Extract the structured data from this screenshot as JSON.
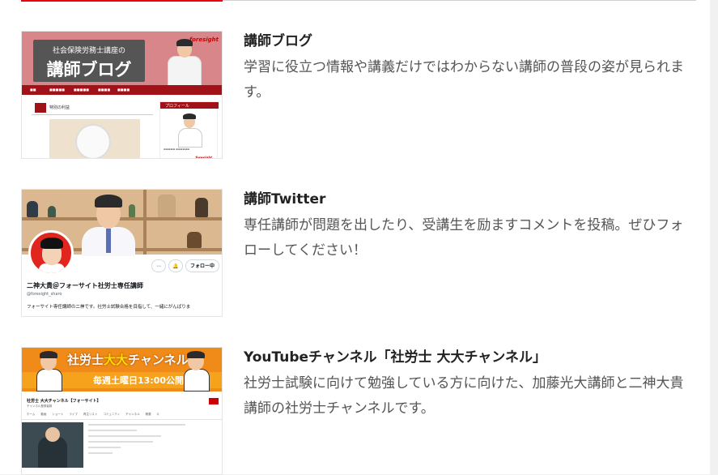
{
  "items": [
    {
      "title": "講師ブログ",
      "description": "学習に役立つ情報や講義だけではわからない講師の普段の姿が見られます。",
      "thumbnail": {
        "banner_sub": "社会保険労務士講座の",
        "banner_title": "講師ブログ",
        "logo": "foresight",
        "post_title": "特別の利益",
        "profile_label": "プロフィール"
      }
    },
    {
      "title": "講師Twitter",
      "description": "専任講師が問題を出したり、受講生を励ますコメントを投稿。ぜひフォローしてください！",
      "thumbnail": {
        "more_glyph": "⋯",
        "notify_glyph": "🔔",
        "follow_label": "フォロー中",
        "display_name": "二神大貴＠フォーサイト社労士専任講師",
        "handle": "@foresight_sharo",
        "bio": "フォーサイト専任講師の二神です。社労士試験合格を目指して、一緒にがんばりま"
      }
    },
    {
      "title": "YouTubeチャンネル「社労士 大大チャンネル」",
      "description": "社労士試験に向けて勉強している方に向けた、加藤光大講師と二神大貴講師の社労士チャンネルです。",
      "thumbnail": {
        "banner_title_pre": "社労士",
        "banner_title_hl": "大大",
        "banner_title_post": "チャンネル",
        "schedule": "毎週土曜日13:00公開",
        "channel_name": "社労士 大大チャンネル【フォーサイト】",
        "channel_sub": "チャンネル登録者数",
        "tabs": "ホーム　　動画　　ショート　　ライブ　　再生リスト　　コミュニティ　　チャンネル　　概要　　Q"
      }
    }
  ],
  "colors": {
    "accent_red": "#e60012",
    "title_text": "#222222",
    "desc_text": "#555555"
  }
}
